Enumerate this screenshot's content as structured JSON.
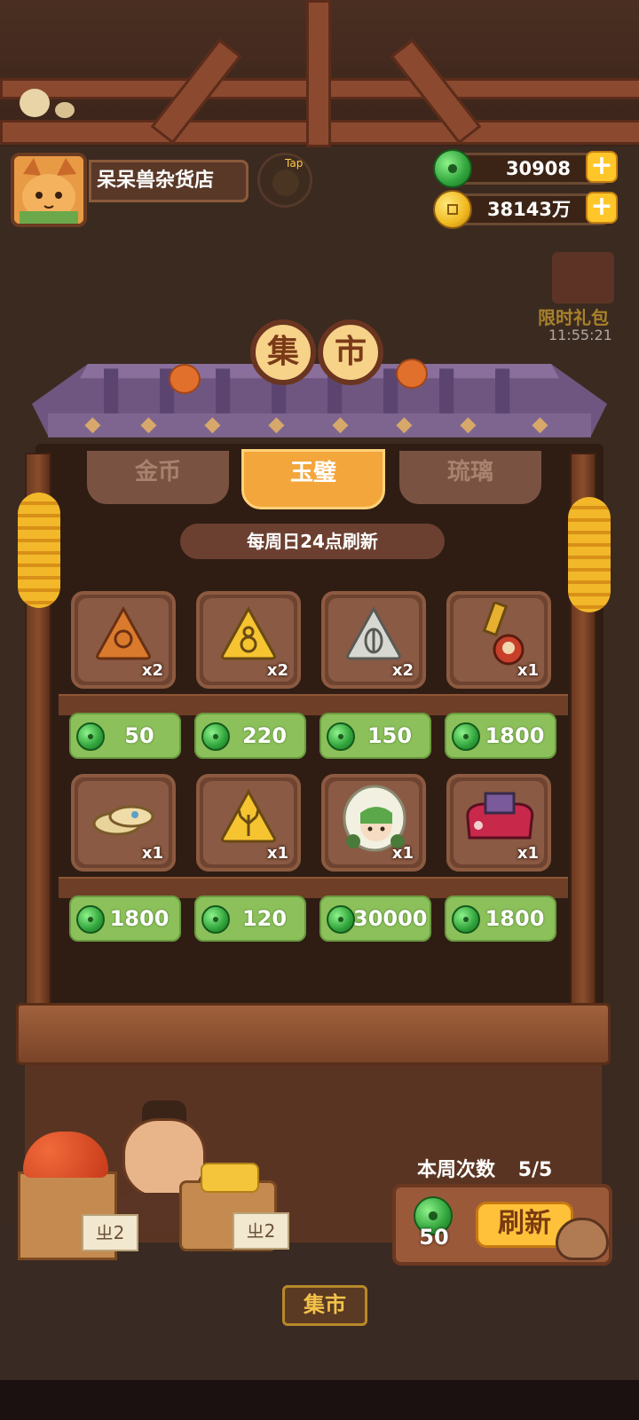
{
  "header": {
    "shop_name": "呆呆兽杂货店",
    "tap_label": "Tap",
    "jade_balance": "30908",
    "coin_balance": "38143万",
    "add_symbol": "+"
  },
  "promo": {
    "label": "限时礼包",
    "timer": "11:55:21"
  },
  "market": {
    "title_chars": [
      "集",
      "市"
    ],
    "tabs": [
      {
        "label": "金币",
        "active": false
      },
      {
        "label": "玉璧",
        "active": true
      },
      {
        "label": "琉璃",
        "active": false
      }
    ],
    "refresh_note": "每周日24点刷新",
    "items": [
      {
        "icon": "sun-token-icon",
        "qty": "x2",
        "price": "50"
      },
      {
        "icon": "gourd-token-icon",
        "qty": "x2",
        "price": "220"
      },
      {
        "icon": "leaf-token-icon",
        "qty": "x2",
        "price": "150"
      },
      {
        "icon": "daruma-key-icon",
        "qty": "x1",
        "price": "1800"
      },
      {
        "icon": "shoes-icon",
        "qty": "x1",
        "price": "1800"
      },
      {
        "icon": "antler-token-icon",
        "qty": "x1",
        "price": "120"
      },
      {
        "icon": "hooded-character-icon",
        "qty": "x1",
        "price": "30000"
      },
      {
        "icon": "red-stool-icon",
        "qty": "x1",
        "price": "1800"
      }
    ]
  },
  "refresh": {
    "weekly_label": "本周次数",
    "weekly_count": "5/5",
    "cost": "50",
    "button_label": "刷新"
  },
  "decor": {
    "crate_sign_1": "ㄓ2",
    "crate_sign_2": "ㄓ2",
    "bottom_sign": "集市"
  },
  "colors": {
    "price_green": "#8cc05a",
    "tab_active": "#f3a63c",
    "button_yellow": "#ffc13a"
  }
}
